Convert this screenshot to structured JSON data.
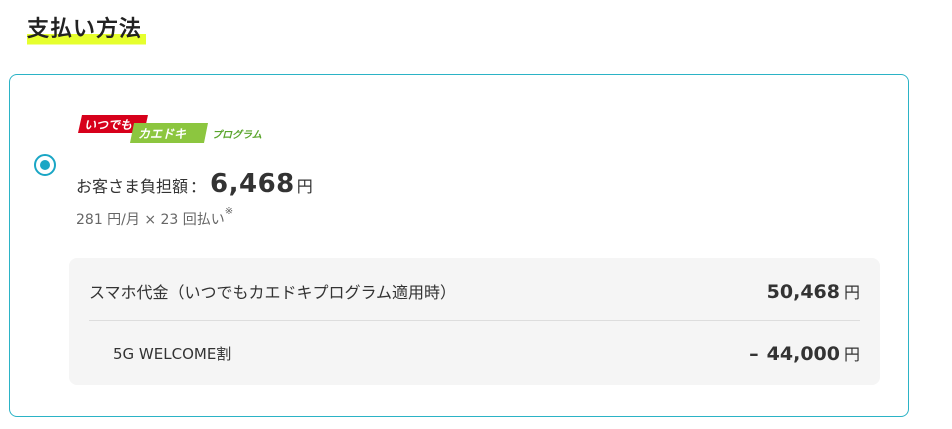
{
  "section": {
    "title": "支払い方法"
  },
  "option": {
    "selected": true,
    "logo": {
      "part1": "いつでも",
      "part2": "カエドキ",
      "part3": "プログラム",
      "colors": {
        "red": "#d7001b",
        "green": "#8cc63f",
        "greenText": "#5aa52c"
      }
    },
    "price_label": "お客さま負担額",
    "price_colon": "：",
    "price_value": "6,468",
    "price_unit": "円",
    "monthly_text": "281 円/月 × 23 回払い",
    "monthly_note": "※"
  },
  "breakdown": {
    "rows": [
      {
        "label": "スマホ代金（いつでもカエドキプログラム適用時）",
        "sign": "",
        "amount": "50,468",
        "unit": "円"
      },
      {
        "label": "5G WELCOME割",
        "sign": "–",
        "amount": "44,000",
        "unit": "円"
      }
    ]
  },
  "colors": {
    "accent": "#1aa6c5",
    "highlight": "#e6ff2e",
    "border": "#2bb3c6"
  }
}
